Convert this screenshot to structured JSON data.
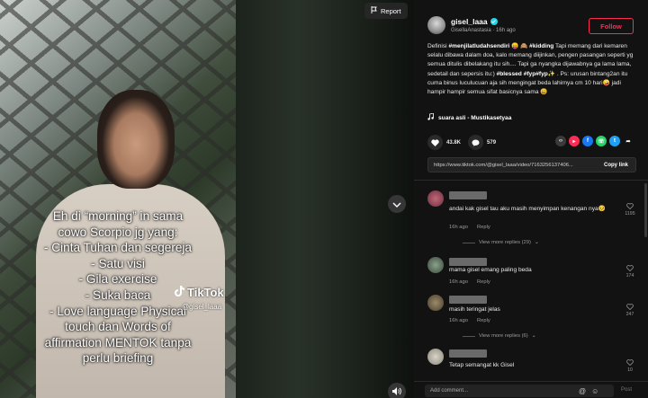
{
  "video": {
    "report_label": "Report",
    "overlay_lines": [
      "Eh di “morning” in sama",
      "cowo Scorpio jg yang:",
      "- Cinta Tuhan dan segereja",
      "- Satu visi",
      "- Gila exercise",
      "- Suka baca",
      "- Love language Physical",
      "touch dan Words of",
      "affirmation MENTOK tanpa",
      "perlu briefing"
    ],
    "watermark_brand": "TikTok",
    "watermark_handle": "@gisel_laaa"
  },
  "author": {
    "username": "gisel_laaa",
    "display_name": "GisellaAnastasia",
    "separator": "·",
    "time_ago": "16h ago",
    "follow_label": "Follow"
  },
  "caption": {
    "p1": "Definisi ",
    "tag1": "#menjilatludahsendiri",
    "p2": " 😛 🙈 ",
    "tag2": "#kidding",
    "p3": " Tapi memang dari kemaren selalu dibawa dalam doa, kalo memang diijinkan, pengen pasangan seperti yg semua ditulis dibelakang itu sih.... Tapi ga nyangka dijawabnya ga lama lama, sedetail dan sepersis itu:) ",
    "tag3": "#blessed",
    "tag4": "#fyp",
    "tag5": "#fyp",
    "p4": "✨ . Ps: urusan bintang2an itu cuma binus luculucuan aja sih mengingat beda lahirnya cm 10 hari🤪 jadi hampir hampir semua sifat basicnya sama 😄"
  },
  "music": {
    "label": "suara asli - Mustikasetyaa"
  },
  "stats": {
    "likes": "43.8K",
    "comments": "579"
  },
  "share": {
    "link": "https://www.tiktok.com/@gisel_laaa/video/7163256137406...",
    "copy_label": "Copy link"
  },
  "comments": [
    {
      "text": "andai kak gisel tau aku masih menyimpan kenangan nya🥺",
      "time": "16h ago",
      "reply": "Reply",
      "likes": "1195",
      "more": "View more replies (29)"
    },
    {
      "text": "mama gisel emang paling beda",
      "time": "16h ago",
      "reply": "Reply",
      "likes": "174",
      "more": ""
    },
    {
      "text": "masih teringat jelas",
      "time": "16h ago",
      "reply": "Reply",
      "likes": "247",
      "more": "View more replies (6)"
    },
    {
      "text": "Tetap semangat kk Gisel",
      "time": "",
      "reply": "",
      "likes": "10",
      "more": ""
    }
  ],
  "add_comment": {
    "placeholder": "Add comment...",
    "post_label": "Post"
  },
  "colors": {
    "accent": "#fe2c55",
    "verified": "#20d5ec"
  }
}
